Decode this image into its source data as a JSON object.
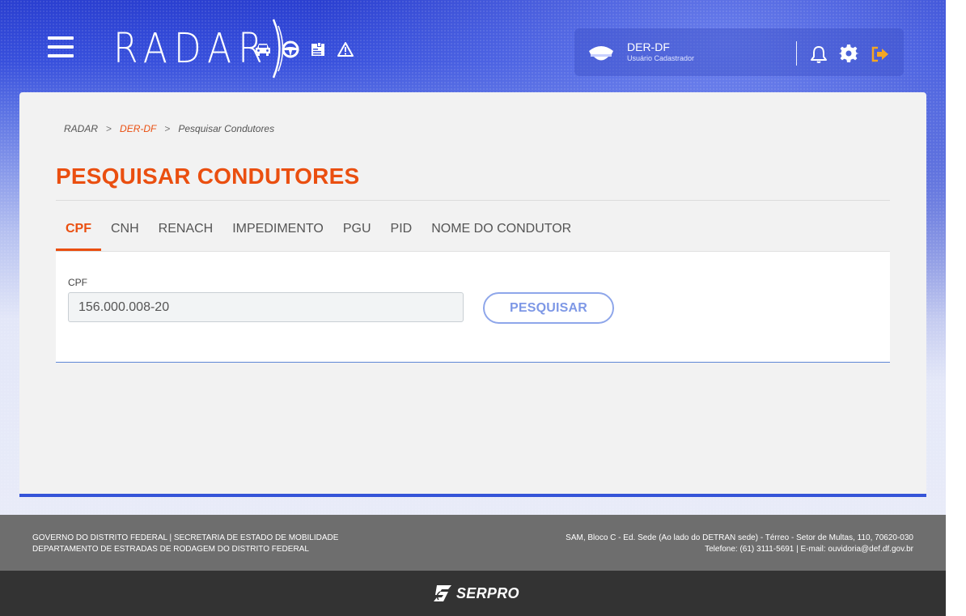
{
  "app": {
    "logo_text": "RADAR",
    "header_icons": [
      "car-icon",
      "steering-wheel-icon",
      "document-stamp-icon",
      "warning-icon"
    ]
  },
  "user": {
    "name": "DER-DF",
    "role": "Usuário Cadastrador"
  },
  "breadcrumb": {
    "items": [
      "RADAR",
      "DER-DF",
      "Pesquisar Condutores"
    ],
    "separator": ">"
  },
  "page": {
    "title": "PESQUISAR CONDUTORES"
  },
  "tabs": [
    {
      "label": "CPF",
      "active": true
    },
    {
      "label": "CNH",
      "active": false
    },
    {
      "label": "RENACH",
      "active": false
    },
    {
      "label": "IMPEDIMENTO",
      "active": false
    },
    {
      "label": "PGU",
      "active": false
    },
    {
      "label": "PID",
      "active": false
    },
    {
      "label": "NOME DO CONDUTOR",
      "active": false
    }
  ],
  "form": {
    "field_label": "CPF",
    "field_value": "156.000.008-20",
    "search_label": "PESQUISAR"
  },
  "footer": {
    "left_line1": "GOVERNO DO DISTRITO FEDERAL | SECRETARIA DE ESTADO DE MOBILIDADE",
    "left_line2": "DEPARTAMENTO DE ESTRADAS DE RODAGEM DO DISTRITO FEDERAL",
    "right_line1": "SAM, Bloco C - Ed. Sede (Ao lado do DETRAN sede) - Térreo - Setor de Multas, 110, 70620-030",
    "right_line2": "Telefone: (61) 3111-5691 | E-mail: ouvidoria@def.df.gov.br",
    "brand": "SERPRO"
  },
  "colors": {
    "accent": "#ea4f10",
    "primary": "#3554d8",
    "button_text": "#7e98e6",
    "exit_icon": "#f5a623"
  }
}
